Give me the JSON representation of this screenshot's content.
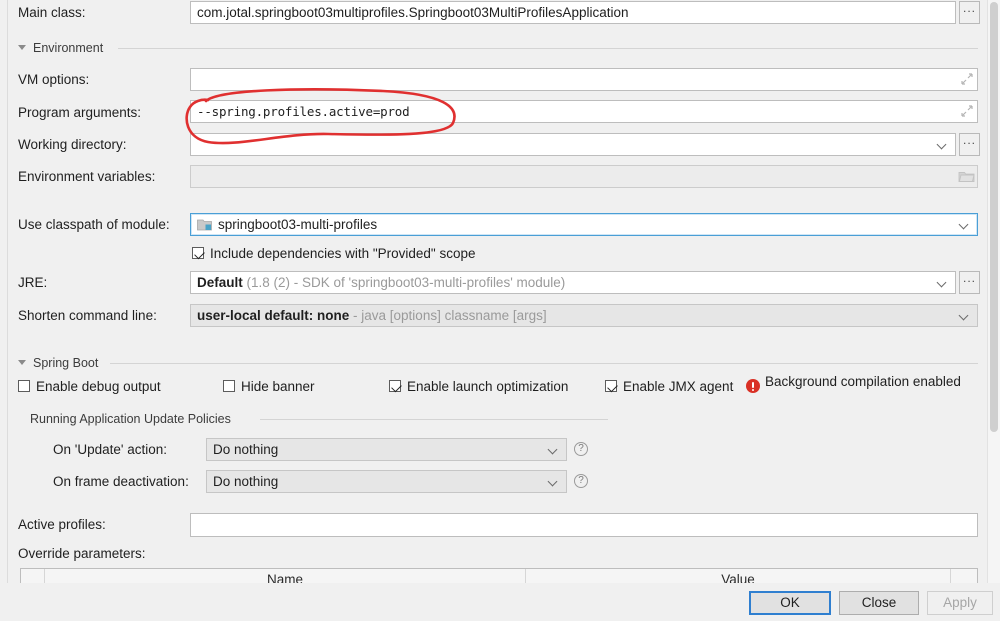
{
  "dialog": {
    "fields": {
      "main_class": {
        "label": "Main class:",
        "value": "com.jotal.springboot03multiprofiles.Springboot03MultiProfilesApplication",
        "browse": "..."
      },
      "vm_options": {
        "label": "VM options:",
        "value": ""
      },
      "program_arguments": {
        "label": "Program arguments:",
        "value": "--spring.profiles.active=prod"
      },
      "working_directory": {
        "label": "Working directory:",
        "value": "",
        "browse": "..."
      },
      "environment_variables": {
        "label": "Environment variables:",
        "value": ""
      },
      "use_classpath_of_module": {
        "label": "Use classpath of module:",
        "value": "springboot03-multi-profiles"
      },
      "include_provided": {
        "label_pre": "Include dependencies with ",
        "label": "Include dependencies with \"Provided\" scope",
        "checked": true
      },
      "jre": {
        "label": "JRE:",
        "value_bold": "Default",
        "value_grey": " (1.8 (2) - SDK of 'springboot03-multi-profiles' module)",
        "browse": "..."
      },
      "shorten_command_line": {
        "label": "Shorten command line:",
        "value_bold": "user-local default: none",
        "value_grey": " - java [options] classname [args]"
      },
      "active_profiles": {
        "label": "Active profiles:",
        "value": ""
      },
      "override_parameters": {
        "label": "Override parameters:"
      }
    },
    "sections": {
      "environment": "Environment",
      "spring_boot": "Spring Boot",
      "running_app_update_policies": "Running Application Update Policies"
    },
    "spring_boot_checkboxes": [
      {
        "label": "Enable debug output",
        "checked": false,
        "mnemonic": "d"
      },
      {
        "label": "Hide banner",
        "checked": false,
        "mnemonic": "H"
      },
      {
        "label": "Enable launch optimization",
        "checked": true,
        "mnemonic": "z"
      },
      {
        "label": "Enable JMX agent",
        "checked": true,
        "mnemonic": "X"
      }
    ],
    "background_compilation": {
      "text": "Background compilation enabled",
      "icon": "error-icon",
      "color": "#d93025"
    },
    "update_policies": [
      {
        "label": "On 'Update' action:",
        "value": "Do nothing",
        "help": "?"
      },
      {
        "label": "On frame deactivation:",
        "value": "Do nothing",
        "help": "?"
      }
    ],
    "table": {
      "columns": [
        "Name",
        "Value"
      ]
    },
    "buttons": [
      {
        "label": "OK",
        "state": "default"
      },
      {
        "label": "Close",
        "state": "normal"
      },
      {
        "label": "Apply",
        "state": "disabled"
      }
    ],
    "annotation": {
      "shape": "hand-drawn-ellipse",
      "color": "#e03030",
      "target": "program_arguments"
    }
  }
}
